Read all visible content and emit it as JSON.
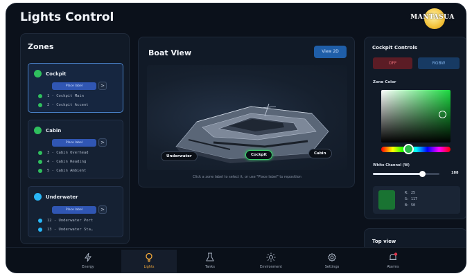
{
  "app": {
    "title": "Lights Control",
    "logo_text": "MANTASUA"
  },
  "zones_panel": {
    "title": "Zones",
    "zones": [
      {
        "name": "Cockpit",
        "color": "#2fbf5e",
        "selected": true,
        "place_label": "Place label",
        "arrow": ">",
        "lights": [
          {
            "label": "1 - Cockpit Main",
            "color": "#2fbf5e"
          },
          {
            "label": "2 - Cockpit Accent",
            "color": "#2fbf5e"
          }
        ]
      },
      {
        "name": "Cabin",
        "color": "#2fbf5e",
        "selected": false,
        "place_label": "Place label",
        "arrow": ">",
        "lights": [
          {
            "label": "3 - Cabin Overhead",
            "color": "#2fbf5e"
          },
          {
            "label": "4 - Cabin Reading",
            "color": "#2fbf5e"
          },
          {
            "label": "5 - Cabin Ambient",
            "color": "#2fbf5e"
          }
        ]
      },
      {
        "name": "Underwater",
        "color": "#29b6f6",
        "selected": false,
        "place_label": "Place label",
        "arrow": ">",
        "lights": [
          {
            "label": "12 - Underwater Port",
            "color": "#29b6f6"
          },
          {
            "label": "13 - Underwater Sta…",
            "color": "#29b6f6"
          }
        ]
      }
    ]
  },
  "boat_view": {
    "title": "Boat View",
    "view_button": "View 2D",
    "labels": {
      "underwater": "Underwater",
      "cockpit": "Cockpit",
      "cabin": "Cabin"
    },
    "hint": "Click a zone label to select it, or use \"Place label\" to reposition"
  },
  "controls": {
    "title": "Cockpit Controls",
    "off_label": "OFF",
    "rgbw_label": "RGBW",
    "zone_color_label": "Zone Color",
    "white_channel_label": "White Channel (W)",
    "white_value": "188",
    "white_level": 188,
    "white_max": 255,
    "swatch_color": "#197332",
    "rgb": {
      "r": "R: 25",
      "g": "G: 117",
      "b": "B: 50"
    }
  },
  "top_view": {
    "title": "Top view"
  },
  "nav": {
    "items": [
      {
        "label": "Energy",
        "icon": "lightning-icon"
      },
      {
        "label": "Lights",
        "icon": "lightbulb-icon",
        "active": true
      },
      {
        "label": "Tanks",
        "icon": "flask-icon"
      },
      {
        "label": "Environment",
        "icon": "sun-icon"
      },
      {
        "label": "Settings",
        "icon": "gear-icon"
      },
      {
        "label": "Alarms",
        "icon": "bell-icon",
        "badge": true
      }
    ],
    "active_color": "#f2a93b"
  }
}
